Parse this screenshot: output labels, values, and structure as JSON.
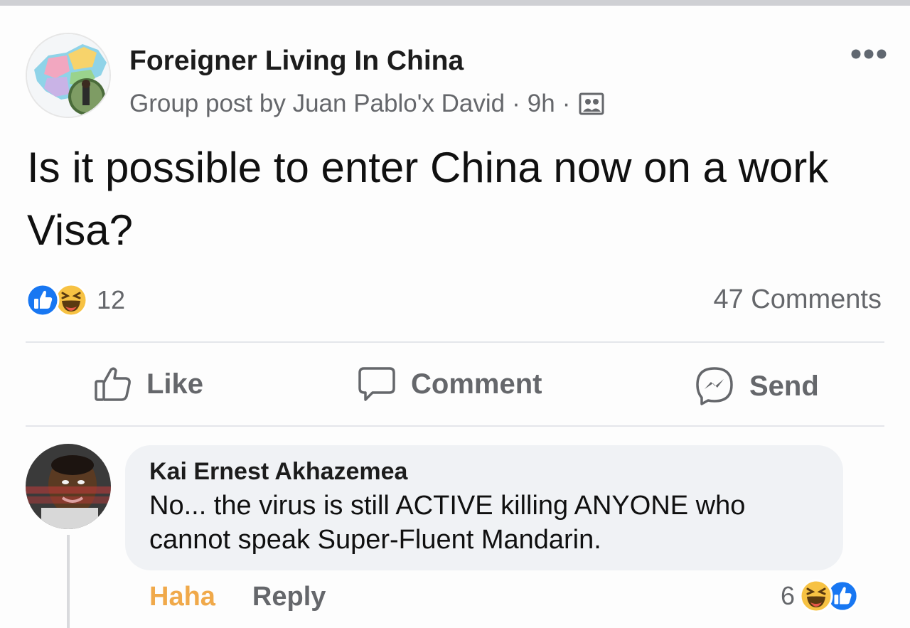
{
  "post": {
    "group_name": "Foreigner Living In China",
    "meta_prefix": "Group post by Juan Pablo'x David",
    "separator": "·",
    "time_ago": "9h",
    "body": "Is it possible to enter China now on a work Visa?",
    "reaction_count": "12",
    "comments_count": "47 Comments"
  },
  "actions": {
    "like": "Like",
    "comment": "Comment",
    "send": "Send"
  },
  "comment": {
    "author": "Kai Ernest Akhazemea",
    "text": "No... the virus is still ACTIVE killing ANYONE who cannot speak Super-Fluent Mandarin.",
    "haha_label": "Haha",
    "reply_label": "Reply",
    "reaction_count": "6"
  },
  "colors": {
    "accent_like": "#1877f2",
    "haha_yellow": "#f7c243",
    "haha_active_text": "#f0a94a",
    "muted_text": "#65676b",
    "bubble_bg": "#f0f2f5"
  },
  "icons": [
    "group-avatar",
    "audience-icon",
    "more-icon",
    "like-reaction-icon",
    "haha-reaction-icon",
    "like-outline-icon",
    "comment-icon",
    "messenger-icon",
    "user-avatar"
  ]
}
